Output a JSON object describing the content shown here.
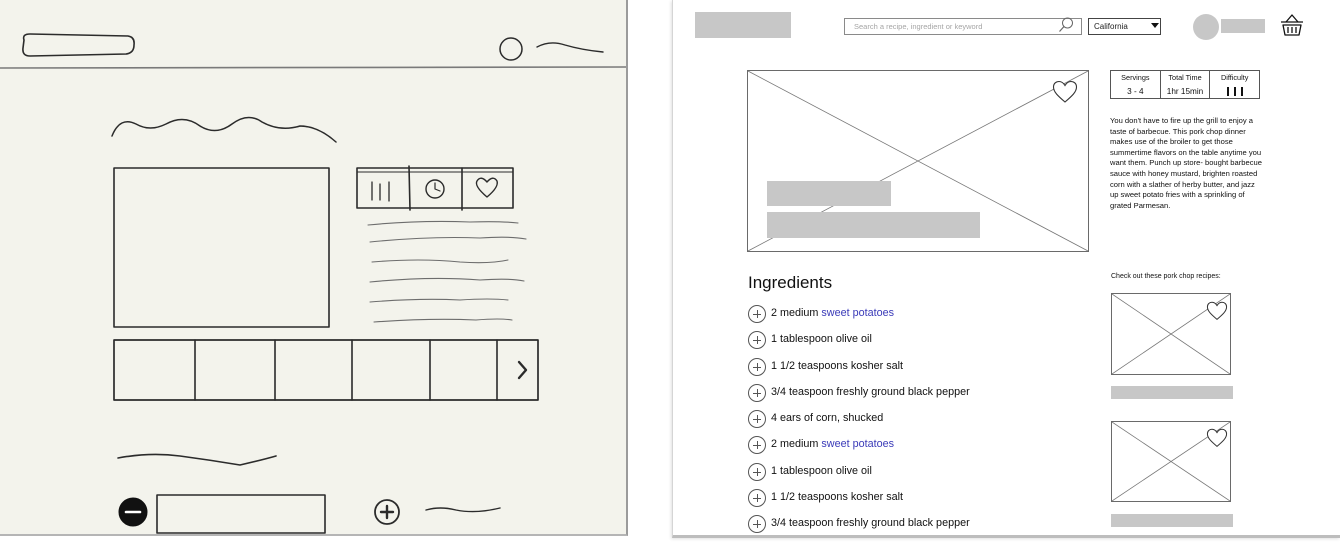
{
  "search": {
    "placeholder": "Search a recipe, ingredient or keyword"
  },
  "region": {
    "selected": "California"
  },
  "recipe": {
    "servings_label": "Servings",
    "servings": "3 - 4",
    "time_label": "Total Time",
    "time": "1hr 15min",
    "difficulty_label": "Difficulty",
    "difficulty_level": 3,
    "description": "You don't have to fire up the grill to enjoy a taste of barbecue. This pork chop dinner makes use of the broiler to get those summertime flavors on the table anytime you want them. Punch up store- bought barbecue sauce with honey mustard, brighten roasted corn with a slather of herby butter, and jazz up sweet potato fries with a sprinkling of grated Parmesan."
  },
  "ingredients": {
    "title": "Ingredients",
    "items": [
      {
        "pre": "2 medium ",
        "link": "sweet potatoes"
      },
      {
        "pre": "1 tablespoon olive oil",
        "link": ""
      },
      {
        "pre": "1 1/2 teaspoons kosher salt",
        "link": ""
      },
      {
        "pre": "3/4 teaspoon freshly ground black pepper",
        "link": ""
      },
      {
        "pre": "4 ears of corn, shucked",
        "link": ""
      },
      {
        "pre": "2 medium ",
        "link": "sweet potatoes"
      },
      {
        "pre": "1 tablespoon olive oil",
        "link": ""
      },
      {
        "pre": "1 1/2 teaspoons kosher salt",
        "link": ""
      },
      {
        "pre": "3/4 teaspoon freshly ground black pepper",
        "link": ""
      }
    ]
  },
  "related": {
    "label": "Check out these pork chop recipes:"
  },
  "colors": {
    "link": "#3a3ab8",
    "placeholder_gray": "#c7c7c7",
    "sketch_bg": "#f3f3ec"
  }
}
